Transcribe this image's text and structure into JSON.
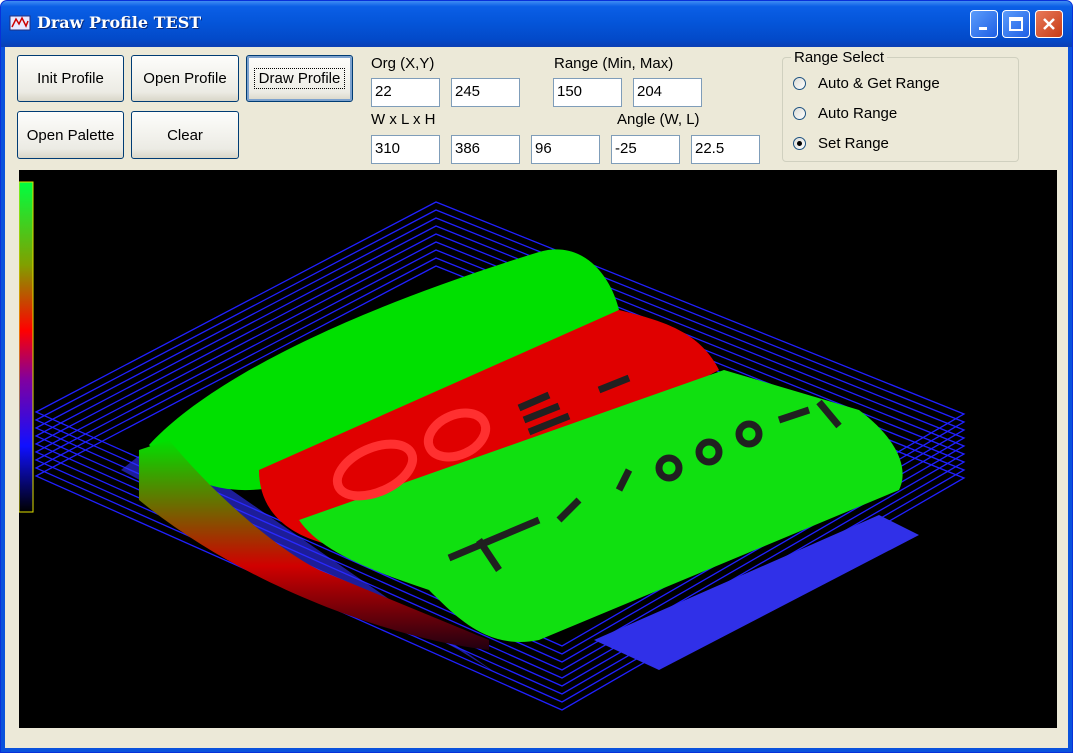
{
  "window": {
    "title": "Draw Profile TEST"
  },
  "buttons": {
    "init_profile": "Init Profile",
    "open_profile": "Open Profile",
    "draw_profile": "Draw Profile",
    "open_palette": "Open Palette",
    "clear": "Clear"
  },
  "params": {
    "org_label": "Org (X,Y)",
    "org_x": "22",
    "org_y": "245",
    "range_label": "Range (Min, Max)",
    "range_min": "150",
    "range_max": "204",
    "wlh_label": "W x L x H",
    "w": "310",
    "l": "386",
    "h": "96",
    "angle_label": "Angle (W, L)",
    "angle_w": "-25",
    "angle_l": "22.5"
  },
  "range_select": {
    "title": "Range Select",
    "options": [
      {
        "label": "Auto & Get Range",
        "selected": false
      },
      {
        "label": "Auto Range",
        "selected": false
      },
      {
        "label": "Set Range",
        "selected": true
      }
    ]
  },
  "icons": {
    "app": "app-icon",
    "minimize": "minimize-icon",
    "maximize": "maximize-icon",
    "close": "close-icon"
  },
  "colors": {
    "grid": "#1a1aff",
    "high": "#00ff00",
    "mid": "#ff0000",
    "low": "#2020ff"
  }
}
